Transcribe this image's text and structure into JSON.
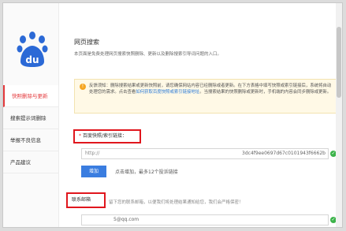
{
  "sidebar": {
    "logo_text": "du",
    "items": [
      {
        "label": "快照删除与更新",
        "active": true
      },
      {
        "label": "搜索提示词删除",
        "active": false
      },
      {
        "label": "举报不良信息",
        "active": false
      },
      {
        "label": "产品建议",
        "active": false
      }
    ]
  },
  "main": {
    "title": "网页搜索",
    "description": "本页面是免费处理网页搜索快照删除、更新以及删除搜索引导词问题的入口。",
    "notice": {
      "icon": "!",
      "text_1": "反馈须知：删除搜索结果或更新快照前，请您确保网站内容已经删除或者更新。在下方表格中填写快照或索引链接后，系统将自动处理您的需求。点击查看",
      "link": "如何获取百度快照或索引链接地址",
      "text_2": "。当搜索结果的快照删除或更新时，手机端的内容会同步删除或更新。"
    },
    "url_field": {
      "required_mark": "*",
      "label": "百度快照/索引链接：",
      "placeholder": "http://",
      "value": "3dc4f9ee0697d67c0101943f6662b"
    },
    "add_button": "增加",
    "add_hint": "点击增加，最多12个投诉链接",
    "contact": {
      "label": "联系邮箱",
      "hint": "留下您的联系邮箱，以便我们将处理结果通知给您，我们会严格保密！",
      "value": "5@qq.com"
    }
  },
  "colors": {
    "accent": "#3a7de0",
    "highlight": "#e0161d",
    "active": "#e4393c"
  }
}
